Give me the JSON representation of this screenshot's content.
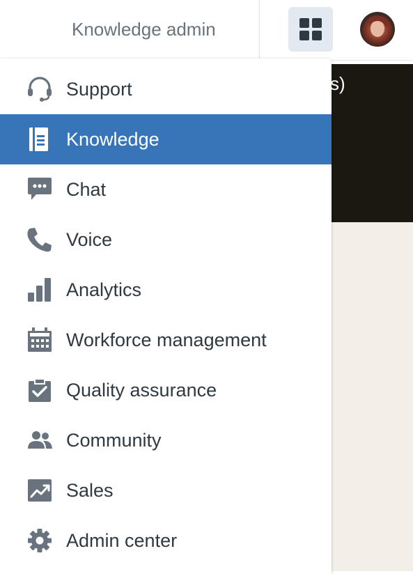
{
  "header": {
    "title": "Knowledge admin",
    "apps_button_icon": "grid-icon",
    "avatar_icon": "user-avatar"
  },
  "background": {
    "partial_text": "s)"
  },
  "menu": {
    "items": [
      {
        "label": "Support",
        "icon": "headset-icon",
        "selected": false
      },
      {
        "label": "Knowledge",
        "icon": "book-icon",
        "selected": true
      },
      {
        "label": "Chat",
        "icon": "chat-bubble-icon",
        "selected": false
      },
      {
        "label": "Voice",
        "icon": "phone-icon",
        "selected": false
      },
      {
        "label": "Analytics",
        "icon": "bar-chart-icon",
        "selected": false
      },
      {
        "label": "Workforce management",
        "icon": "calendar-icon",
        "selected": false
      },
      {
        "label": "Quality assurance",
        "icon": "clipboard-check-icon",
        "selected": false
      },
      {
        "label": "Community",
        "icon": "people-icon",
        "selected": false
      },
      {
        "label": "Sales",
        "icon": "trend-chart-icon",
        "selected": false
      },
      {
        "label": "Admin center",
        "icon": "gear-icon",
        "selected": false
      }
    ]
  },
  "colors": {
    "selected_bg": "#3874b8",
    "icon_color": "#68737d",
    "text_color": "#2f3941",
    "apps_button_bg": "#e3e9f1"
  }
}
